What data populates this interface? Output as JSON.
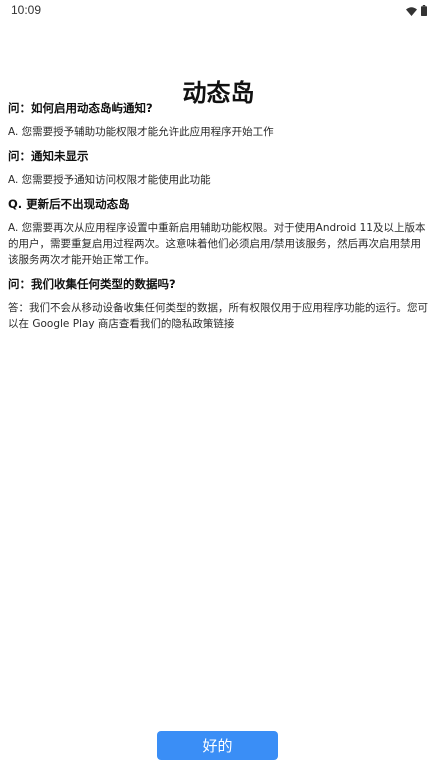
{
  "status_bar": {
    "time": "10:09",
    "icons": [
      "wifi-icon",
      "battery-icon"
    ]
  },
  "title": "动态岛",
  "faq": [
    {
      "question": "问：如何启用动态岛屿通知?",
      "answer": "A. 您需要授予辅助功能权限才能允许此应用程序开始工作"
    },
    {
      "question": "问：通知未显示",
      "answer": "A. 您需要授予通知访问权限才能使用此功能"
    },
    {
      "question": "Q. 更新后不出现动态岛",
      "answer": "A. 您需要再次从应用程序设置中重新启用辅助功能权限。对于使用Android 11及以上版本的用户，需要重复启用过程两次。这意味着他们必须启用/禁用该服务，然后再次启用禁用该服务两次才能开始正常工作。"
    },
    {
      "question": "问：我们收集任何类型的数据吗?",
      "answer": "答：我们不会从移动设备收集任何类型的数据，所有权限仅用于应用程序功能的运行。您可以在 Google Play 商店查看我们的隐私政策链接"
    }
  ],
  "button": {
    "ok_label": "好的",
    "color": "#3a8ef6"
  }
}
